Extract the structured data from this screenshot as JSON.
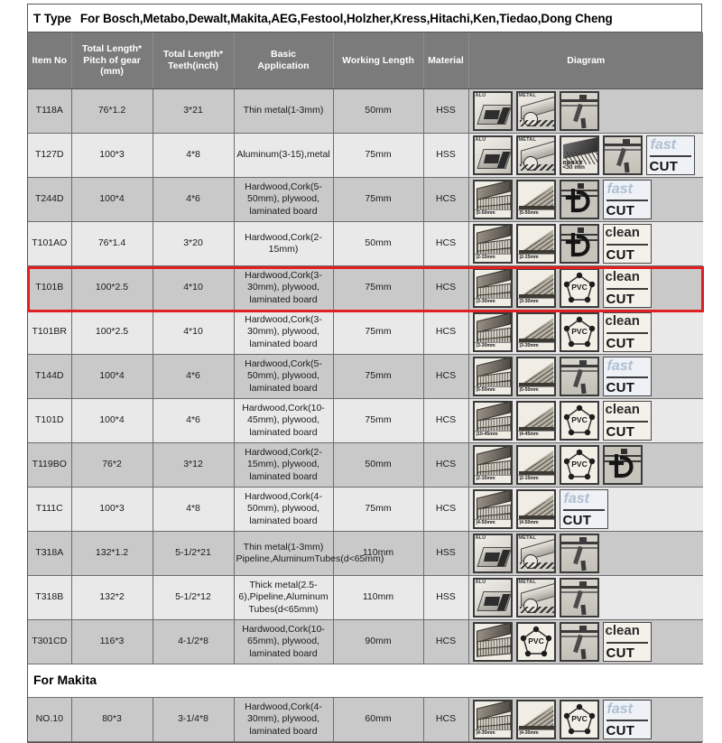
{
  "title": {
    "prefix": "T Type",
    "text": "For Bosch,Metabo,Dewalt,Makita,AEG,Festool,Holzher,Kress,Hitachi,Ken,Tiedao,Dong Cheng"
  },
  "columns": [
    {
      "key": "item_no",
      "label": "Item No"
    },
    {
      "key": "pitch",
      "label": "Total Length*\nPitch of gear\n(mm)",
      "l1": "Total Length*",
      "l2": "Pitch of gear",
      "l3": "(mm)"
    },
    {
      "key": "teeth",
      "label": "Total Length*\nTeeth(inch)",
      "l1": "Total Length*",
      "l2": "Teeth(inch)",
      "l3": ""
    },
    {
      "key": "application",
      "label": "Basic\nApplication",
      "l1": "Basic",
      "l2": "Application",
      "l3": ""
    },
    {
      "key": "working_length",
      "label": "Working Length",
      "l1": "Working Length",
      "l2": "",
      "l3": ""
    },
    {
      "key": "material",
      "label": "Material",
      "l1": "Material",
      "l2": "",
      "l3": ""
    },
    {
      "key": "diagram",
      "label": "Diagram",
      "l1": "Diagram",
      "l2": "",
      "l3": ""
    }
  ],
  "highlight": {
    "item_no": "T101B",
    "color": "#e02020"
  },
  "sections": [
    {
      "type": "table",
      "rows_start": 0
    },
    {
      "type": "section_header",
      "label": "For Makita"
    }
  ],
  "rows": [
    {
      "item_no": "T118A",
      "pitch": "76*1.2",
      "teeth": "3*21",
      "application": "Thin metal(1-3mm)",
      "working_length": "50mm",
      "material": "HSS",
      "icons": [
        "alu-icon",
        "metal-icon",
        "cut-profile-icon"
      ],
      "icon_labels": [
        "ALU",
        "METAL",
        ""
      ],
      "badge": null
    },
    {
      "item_no": "T127D",
      "pitch": "100*3",
      "teeth": "4*8",
      "application": "Aluminum(3-15),metal",
      "working_length": "75mm",
      "material": "HSS",
      "icons": [
        "alu-icon",
        "metal-icon",
        "epoxy-icon",
        "cut-profile-icon"
      ],
      "icon_labels": [
        "ALU",
        "METAL",
        "epoxy <30 mm",
        ""
      ],
      "badge": {
        "top": "fast",
        "bottom": "CUT",
        "style": "fast"
      }
    },
    {
      "item_no": "T244D",
      "pitch": "100*4",
      "teeth": "4*6",
      "application": "Hardwood,Cork(5-50mm), plywood, laminated board",
      "working_length": "75mm",
      "material": "HCS",
      "icons": [
        "wood-board-icon",
        "wood-wedge-icon",
        "hook-icon"
      ],
      "icon_labels": [
        "5-50mm",
        "5-50mm",
        ""
      ],
      "badge": {
        "top": "fast",
        "bottom": "CUT",
        "style": "fast"
      }
    },
    {
      "item_no": "T101AO",
      "pitch": "76*1.4",
      "teeth": "3*20",
      "application": "Hardwood,Cork(2-15mm)",
      "working_length": "50mm",
      "material": "HCS",
      "icons": [
        "wood-board-icon",
        "wood-wedge-icon",
        "hook-icon"
      ],
      "icon_labels": [
        "2-15mm",
        "2-15mm",
        ""
      ],
      "badge": {
        "top": "clean",
        "bottom": "CUT",
        "style": "clean"
      }
    },
    {
      "item_no": "T101B",
      "pitch": "100*2.5",
      "teeth": "4*10",
      "application": "Hardwood,Cork(3-30mm), plywood, laminated board",
      "working_length": "75mm",
      "material": "HCS",
      "icons": [
        "wood-board-icon",
        "wood-wedge-icon",
        "pvc-icon"
      ],
      "icon_labels": [
        "3-30mm",
        "3-30mm",
        "PVC"
      ],
      "badge": {
        "top": "clean",
        "bottom": "CUT",
        "style": "clean"
      }
    },
    {
      "item_no": "T101BR",
      "pitch": "100*2.5",
      "teeth": "4*10",
      "application": "Hardwood,Cork(3-30mm), plywood, laminated board",
      "working_length": "75mm",
      "material": "HCS",
      "icons": [
        "wood-board-icon",
        "wood-wedge-icon",
        "pvc-icon"
      ],
      "icon_labels": [
        "3-30mm",
        "3-30mm",
        "PVC"
      ],
      "badge": {
        "top": "clean",
        "bottom": "CUT",
        "style": "clean"
      }
    },
    {
      "item_no": "T144D",
      "pitch": "100*4",
      "teeth": "4*6",
      "application": "Hardwood,Cork(5-50mm), plywood, laminated board",
      "working_length": "75mm",
      "material": "HCS",
      "icons": [
        "wood-board-icon",
        "wood-wedge-icon",
        "cut-profile-icon"
      ],
      "icon_labels": [
        "5-50mm",
        "5-50mm",
        ""
      ],
      "badge": {
        "top": "fast",
        "bottom": "CUT",
        "style": "fast"
      }
    },
    {
      "item_no": "T101D",
      "pitch": "100*4",
      "teeth": "4*6",
      "application": "Hardwood,Cork(10-45mm), plywood, laminated board",
      "working_length": "75mm",
      "material": "HCS",
      "icons": [
        "wood-board-icon",
        "wood-wedge-icon",
        "pvc-icon"
      ],
      "icon_labels": [
        "10-45mm",
        "4-45mm",
        "PVC"
      ],
      "badge": {
        "top": "clean",
        "bottom": "CUT",
        "style": "clean"
      }
    },
    {
      "item_no": "T119BO",
      "pitch": "76*2",
      "teeth": "3*12",
      "application": "Hardwood,Cork(2-15mm), plywood, laminated board",
      "working_length": "50mm",
      "material": "HCS",
      "icons": [
        "wood-board-icon",
        "wood-wedge-icon",
        "pvc-icon",
        "hook-icon"
      ],
      "icon_labels": [
        "2-15mm",
        "2-15mm",
        "PVC",
        ""
      ],
      "badge": null
    },
    {
      "item_no": "T111C",
      "pitch": "100*3",
      "teeth": "4*8",
      "application": "Hardwood,Cork(4-50mm), plywood, laminated board",
      "working_length": "75mm",
      "material": "HCS",
      "icons": [
        "wood-board-icon",
        "wood-wedge-icon"
      ],
      "icon_labels": [
        "4-50mm",
        "4-50mm"
      ],
      "badge": {
        "top": "fast",
        "bottom": "CUT",
        "style": "fast"
      }
    },
    {
      "item_no": "T318A",
      "pitch": "132*1.2",
      "teeth": "5-1/2*21",
      "application": "Thin metal(1-3mm) Pipeline,AluminumTubes(d<65mm)",
      "working_length": "110mm",
      "material": "HSS",
      "icons": [
        "alu-icon",
        "metal-icon",
        "cut-profile-icon"
      ],
      "icon_labels": [
        "ALU",
        "METAL",
        ""
      ],
      "badge": null
    },
    {
      "item_no": "T318B",
      "pitch": "132*2",
      "teeth": "5-1/2*12",
      "application": "Thick metal(2.5-6),Pipeline,Aluminum Tubes(d<65mm)",
      "working_length": "110mm",
      "material": "HSS",
      "icons": [
        "alu-icon",
        "metal-icon",
        "cut-profile-icon"
      ],
      "icon_labels": [
        "ALU",
        "METAL",
        ""
      ],
      "badge": null
    },
    {
      "item_no": "T301CD",
      "pitch": "116*3",
      "teeth": "4-1/2*8",
      "application": "Hardwood,Cork(10-65mm), plywood, laminated board",
      "working_length": "90mm",
      "material": "HCS",
      "icons": [
        "wood-board-icon",
        "pvc-icon",
        "cut-profile-icon"
      ],
      "icon_labels": [
        "",
        "PVC",
        ""
      ],
      "badge": {
        "top": "clean",
        "bottom": "CUT",
        "style": "clean"
      }
    },
    {
      "item_no": "NO.10",
      "pitch": "80*3",
      "teeth": "3-1/4*8",
      "application": "Hardwood,Cork(4-30mm), plywood, laminated board",
      "working_length": "60mm",
      "material": "HCS",
      "icons": [
        "wood-board-icon",
        "wood-wedge-icon",
        "pvc-icon"
      ],
      "icon_labels": [
        "4-30mm",
        "4-30mm",
        "PVC"
      ],
      "badge": {
        "top": "fast",
        "bottom": "CUT",
        "style": "fast"
      },
      "section": "For Makita"
    }
  ],
  "theme": {
    "header_bg": "#7b7b7b",
    "header_fg": "#ffffff",
    "row_odd_bg": "#c9c9c9",
    "row_even_bg": "#e9e9e9",
    "grid": "#6d6d6d",
    "highlight": "#e02020"
  }
}
